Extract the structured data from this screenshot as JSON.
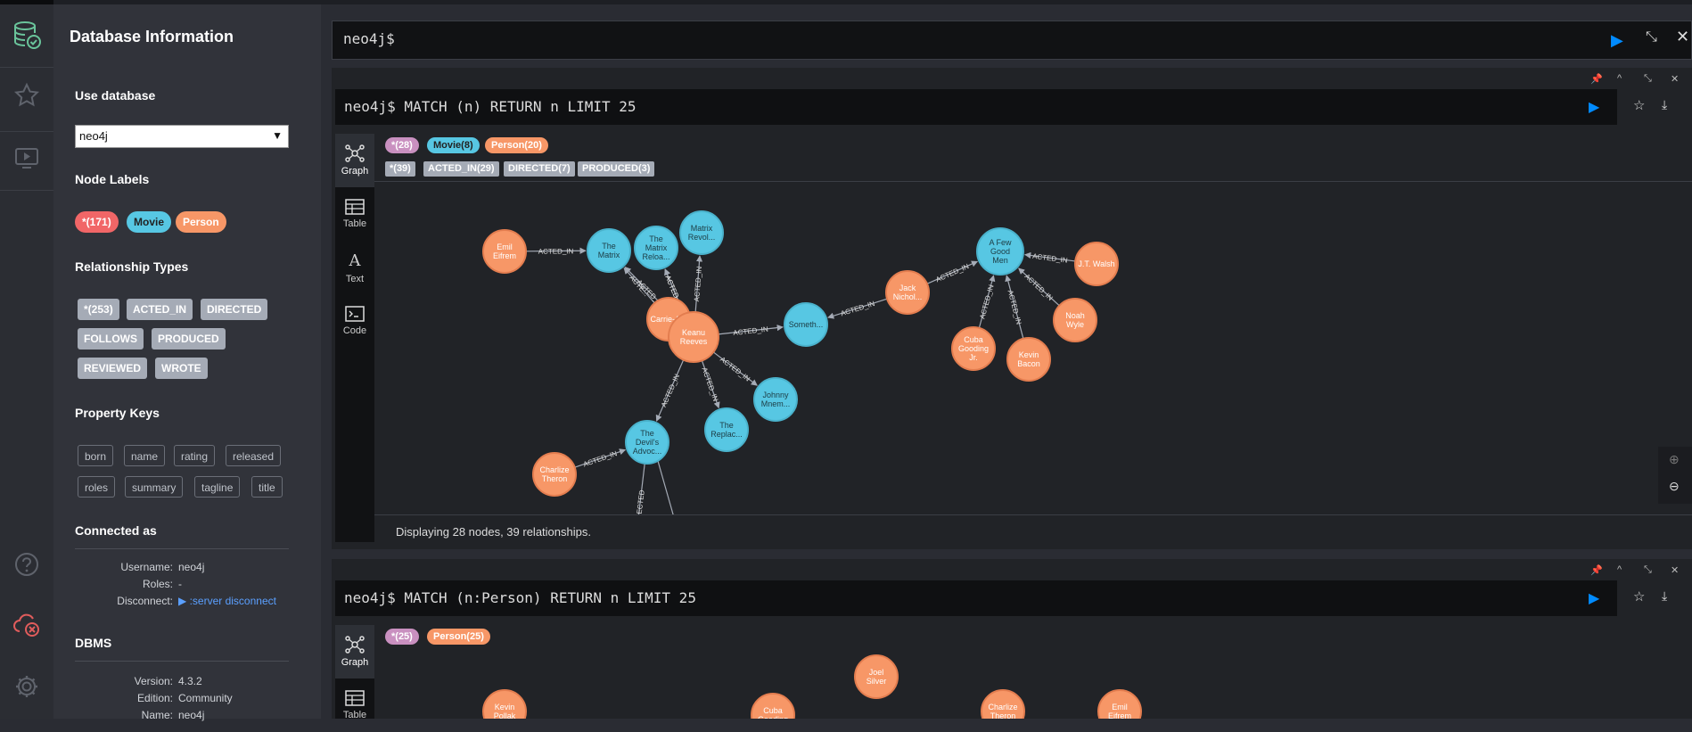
{
  "colors": {
    "movie": "#57c7e3",
    "person": "#f79767",
    "all_nodes": "#c990c0",
    "all_nodes_sidebar": "#f16667",
    "rel": "#a5abb6",
    "accent": "#018bff",
    "bg": "#212327"
  },
  "sidebar": {
    "title": "Database Information",
    "use_database": "Use database",
    "selected_db": "neo4j",
    "node_labels_title": "Node Labels",
    "node_labels": [
      "*(171)",
      "Movie",
      "Person"
    ],
    "rel_types_title": "Relationship Types",
    "rel_types": [
      "*(253)",
      "ACTED_IN",
      "DIRECTED",
      "FOLLOWS",
      "PRODUCED",
      "REVIEWED",
      "WROTE"
    ],
    "prop_keys_title": "Property Keys",
    "prop_keys": [
      "born",
      "name",
      "rating",
      "released",
      "roles",
      "summary",
      "tagline",
      "title"
    ],
    "connected_title": "Connected as",
    "username_label": "Username:",
    "username": "neo4j",
    "roles_label": "Roles:",
    "roles": "-",
    "disconnect_label": "Disconnect:",
    "disconnect_cmd": ":server disconnect",
    "dbms_title": "DBMS",
    "version_label": "Version:",
    "version": "4.3.2",
    "edition_label": "Edition:",
    "edition": "Community",
    "name_label": "Name:",
    "name": "neo4j"
  },
  "editor": {
    "prompt": "neo4j$"
  },
  "frame1": {
    "query": "neo4j$ MATCH (n) RETURN n LIMIT 25",
    "node_pills": [
      "*(28)",
      "Movie(8)",
      "Person(20)"
    ],
    "rel_pills": [
      "*(39)",
      "ACTED_IN(29)",
      "DIRECTED(7)",
      "PRODUCED(3)"
    ],
    "status": "Displaying 28 nodes, 39 relationships.",
    "tabs": [
      "Graph",
      "Table",
      "Text",
      "Code"
    ],
    "nodes": [
      {
        "l1": "Emil",
        "l2": "Eifrem",
        "type": "person"
      },
      {
        "l1": "The",
        "l2": "Matrix",
        "type": "movie"
      },
      {
        "l1": "The",
        "l2": "Matrix",
        "l3": "Reloa...",
        "type": "movie"
      },
      {
        "l1": "Matrix",
        "l2": "Revol...",
        "type": "movie"
      },
      {
        "l1": "Carrie-A...",
        "type": "person"
      },
      {
        "l1": "Keanu",
        "l2": "Reeves",
        "type": "person"
      },
      {
        "l1": "Someth...",
        "type": "movie"
      },
      {
        "l1": "Jack",
        "l2": "Nichol...",
        "type": "person"
      },
      {
        "l1": "A Few",
        "l2": "Good",
        "l3": "Men",
        "type": "movie"
      },
      {
        "l1": "J.T. Walsh",
        "type": "person"
      },
      {
        "l1": "Noah",
        "l2": "Wyle",
        "type": "person"
      },
      {
        "l1": "Kevin",
        "l2": "Bacon",
        "type": "person"
      },
      {
        "l1": "Cuba",
        "l2": "Gooding",
        "l3": "Jr.",
        "type": "person"
      },
      {
        "l1": "Johnny",
        "l2": "Mnem...",
        "type": "movie"
      },
      {
        "l1": "The",
        "l2": "Replac...",
        "type": "movie"
      },
      {
        "l1": "The",
        "l2": "Devil's",
        "l3": "Advoc...",
        "type": "movie"
      },
      {
        "l1": "Charlize",
        "l2": "Theron",
        "type": "person"
      }
    ],
    "edges": [
      {
        "label": "ACTED_IN"
      },
      {
        "label": "ACTE..."
      },
      {
        "label": "ACTED_IN"
      },
      {
        "label": "ACTED_IN"
      },
      {
        "label": "ACTED_IN"
      },
      {
        "label": "ACTED_IN"
      },
      {
        "label": "ACTED_IN"
      },
      {
        "label": "ACTED_IN"
      },
      {
        "label": "ACTED_IN"
      },
      {
        "label": "ACTED_IN"
      },
      {
        "label": "ACTED_IN"
      },
      {
        "label": "ACTED_IN"
      },
      {
        "label": "ACTED_IN"
      },
      {
        "label": "ACTED_IN"
      },
      {
        "label": "ACTED_IN"
      },
      {
        "label": "ACTED_IN"
      },
      {
        "label": "IRECTED"
      },
      {
        "label": "ACTED_IN"
      }
    ]
  },
  "frame2": {
    "query": "neo4j$ MATCH (n:Person) RETURN n LIMIT 25",
    "node_pills": [
      "*(25)",
      "Person(25)"
    ],
    "tabs": [
      "Graph",
      "Table"
    ],
    "nodes": [
      {
        "l1": "Kevin",
        "l2": "Pollak"
      },
      {
        "l1": "Cuba",
        "l2": "Gooding"
      },
      {
        "l1": "Joel",
        "l2": "Silver"
      },
      {
        "l1": "Charlize",
        "l2": "Theron"
      },
      {
        "l1": "Emil",
        "l2": "Eifrem"
      }
    ]
  }
}
